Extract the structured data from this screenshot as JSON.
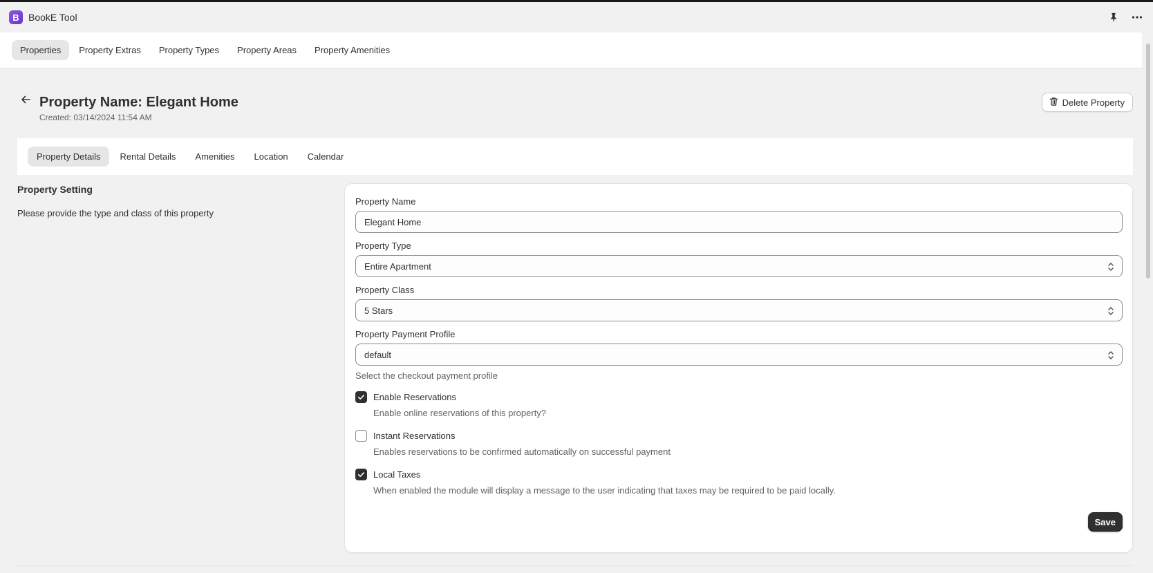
{
  "app": {
    "logo_letter": "B",
    "title": "BookE Tool",
    "pin_icon": "pin-icon",
    "more_icon": "more-horizontal-icon",
    "logo_color": "#7b45d4"
  },
  "nav": {
    "tabs": [
      {
        "label": "Properties",
        "active": true
      },
      {
        "label": "Property Extras",
        "active": false
      },
      {
        "label": "Property Types",
        "active": false
      },
      {
        "label": "Property Areas",
        "active": false
      },
      {
        "label": "Property Amenities",
        "active": false
      }
    ]
  },
  "header": {
    "back_icon": "arrow-left-icon",
    "title": "Property Name: Elegant Home",
    "created": "Created: 03/14/2024 11:54 AM",
    "delete_label": "Delete Property",
    "delete_icon": "trash-icon"
  },
  "subtabs": [
    {
      "label": "Property Details",
      "active": true
    },
    {
      "label": "Rental Details",
      "active": false
    },
    {
      "label": "Amenities",
      "active": false
    },
    {
      "label": "Location",
      "active": false
    },
    {
      "label": "Calendar",
      "active": false
    }
  ],
  "section": {
    "title": "Property Setting",
    "description": "Please provide the type and class of this property"
  },
  "form": {
    "property_name": {
      "label": "Property Name",
      "value": "Elegant Home"
    },
    "property_type": {
      "label": "Property Type",
      "value": "Entire Apartment"
    },
    "property_class": {
      "label": "Property Class",
      "value": "5 Stars"
    },
    "payment_profile": {
      "label": "Property Payment Profile",
      "value": "default",
      "help": "Select the checkout payment profile"
    },
    "checkboxes": [
      {
        "label": "Enable Reservations",
        "help": "Enable online reservations of this property?",
        "checked": true
      },
      {
        "label": "Instant Reservations",
        "help": "Enables reservations to be confirmed automatically on successful payment",
        "checked": false
      },
      {
        "label": "Local Taxes",
        "help": "When enabled the module will display a message to the user indicating that taxes may be required to be paid locally.",
        "checked": true
      }
    ],
    "save_label": "Save"
  },
  "colors": {
    "primary_button": "#303030",
    "background": "#f1f1f1",
    "surface": "#ffffff"
  }
}
